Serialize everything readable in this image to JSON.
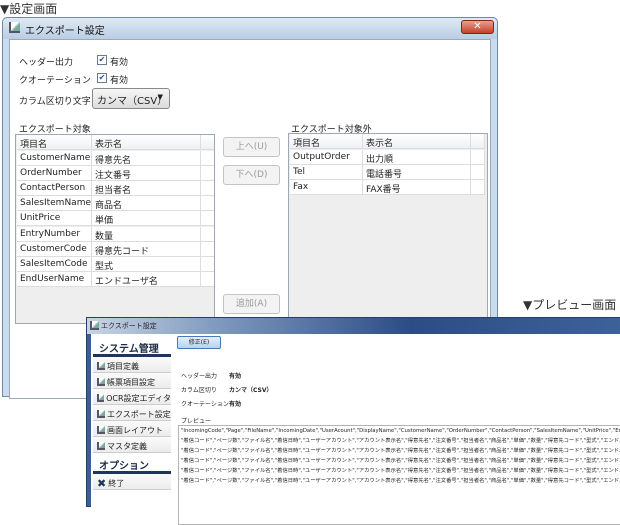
{
  "captions": {
    "settings": "▼設定画面",
    "preview": "▼プレビュー画面"
  },
  "settings_window": {
    "title": "エクスポート設定",
    "close": "✕",
    "header_output": {
      "label": "ヘッダー出力",
      "checked": true,
      "value": "有効"
    },
    "quotation": {
      "label": "クオーテーション",
      "checked": true,
      "value": "有効"
    },
    "delimiter": {
      "label": "カラム区切り文字",
      "selected": "カンマ（CSV）"
    },
    "export_target": {
      "label": "エクスポート対象",
      "columns": [
        "項目名",
        "表示名"
      ],
      "rows": [
        [
          "CustomerName",
          "得意先名"
        ],
        [
          "OrderNumber",
          "注文番号"
        ],
        [
          "ContactPerson",
          "担当者名"
        ],
        [
          "SalesItemName",
          "商品名"
        ],
        [
          "UnitPrice",
          "単価"
        ],
        [
          "EntryNumber",
          "数量"
        ],
        [
          "CustomerCode",
          "得意先コード"
        ],
        [
          "SalesItemCode",
          "型式"
        ],
        [
          "EndUserName",
          "エンドユーザ名"
        ]
      ]
    },
    "excluded": {
      "label": "エクスポート対象外",
      "columns": [
        "項目名",
        "表示名"
      ],
      "rows": [
        [
          "OutputOrder",
          "出力順"
        ],
        [
          "Tel",
          "電話番号"
        ],
        [
          "Fax",
          "FAX番号"
        ]
      ]
    },
    "buttons": {
      "up": "上へ(U)",
      "down": "下へ(D)",
      "add": "追加(A)"
    }
  },
  "preview_window": {
    "title": "エクスポート設定",
    "sidebar": {
      "section1": "システム管理",
      "items": [
        "項目定義",
        "帳票項目設定",
        "OCR設定エディタ",
        "エクスポート設定",
        "画面レイアウト",
        "マスタ定義"
      ],
      "section2": "オプション",
      "exit": "終了"
    },
    "edit_button": "修正(E)",
    "fields": [
      {
        "label": "ヘッダー出力",
        "value": "有効"
      },
      {
        "label": "カラム区切り",
        "value": "カンマ（CSV）"
      },
      {
        "label": "クオーテーション",
        "value": "有効"
      }
    ],
    "preview_label": "プレビュー",
    "preview_lines": [
      "\"IncomingCode\",\"Page\",\"FileName\",\"IncomingDate\",\"UserAcount\",\"DisplayName\",\"CustomerName\",\"OrderNumber\",\"ContactPerson\",\"SalesItemName\",\"UnitPrice\",\"EntryNumber\"",
      "\"着信コード\",\"ページ数\",\"ファイル名\",\"着信日時\",\"ユーザーアカウント\",\"アカウント表示名\",\"得意先名\",\"注文番号\",\"担当者名\",\"商品名\",\"単価\",\"数量\",\"得意先コード\",\"型式\",\"エンドユーザ名\"",
      "\"着信コード\",\"ページ数\",\"ファイル名\",\"着信日時\",\"ユーザーアカウント\",\"アカウント表示名\",\"得意先名\",\"注文番号\",\"担当者名\",\"商品名\",\"単価\",\"数量\",\"得意先コード\",\"型式\",\"エンドユーザ名\"",
      "\"着信コード\",\"ページ数\",\"ファイル名\",\"着信日時\",\"ユーザーアカウント\",\"アカウント表示名\",\"得意先名\",\"注文番号\",\"担当者名\",\"商品名\",\"単価\",\"数量\",\"得意先コード\",\"型式\",\"エンドユーザ名\"",
      "\"着信コード\",\"ページ数\",\"ファイル名\",\"着信日時\",\"ユーザーアカウント\",\"アカウント表示名\",\"得意先名\",\"注文番号\",\"担当者名\",\"商品名\",\"単価\",\"数量\",\"得意先コード\",\"型式\",\"エンドユーザ名\"",
      "\"着信コード\",\"ページ数\",\"ファイル名\",\"着信日時\",\"ユーザーアカウント\",\"アカウント表示名\",\"得意先名\",\"注文番号\",\"担当者名\",\"商品名\",\"単価\",\"数量\",\"得意先コード\",\"型式\",\"エンドユーザ名\""
    ]
  }
}
